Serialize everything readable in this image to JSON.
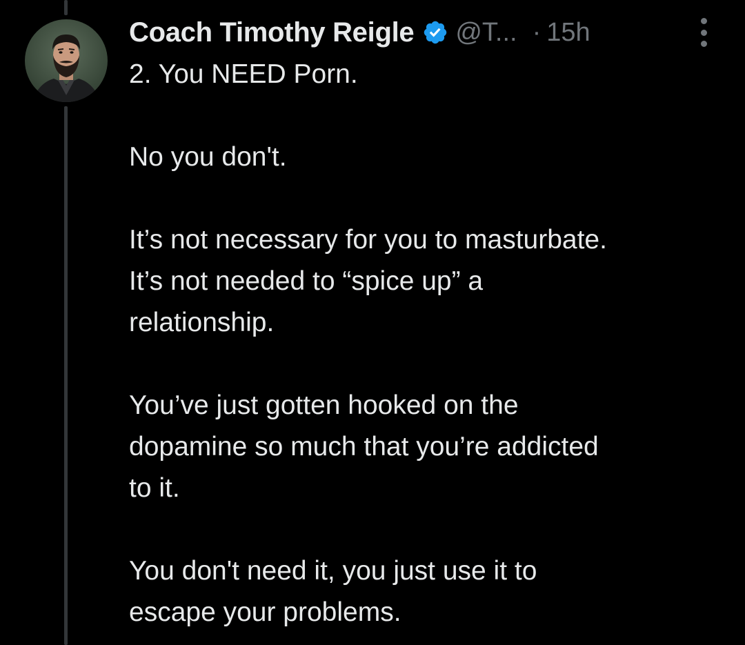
{
  "tweet": {
    "author": {
      "display_name": "Coach Timothy Reigle",
      "handle": "@T...",
      "verified": true,
      "avatar_icon": "profile-photo-bearded-man"
    },
    "separator": "·",
    "time": "15h",
    "more_icon": "vertical-ellipsis-icon",
    "paragraphs": [
      [
        "2. You NEED Porn."
      ],
      [
        "No you don't."
      ],
      [
        "It’s not necessary for you to masturbate.",
        "It’s not needed to “spice up” a",
        "relationship."
      ],
      [
        "You’ve just gotten hooked on the",
        "dopamine so much that you’re addicted",
        "to it."
      ],
      [
        "You don't need it, you just use it to",
        "escape your problems."
      ]
    ]
  },
  "colors": {
    "background": "#000000",
    "text": "#e7e9ea",
    "secondary_text": "#71767b",
    "verified_badge": "#1d9bf0",
    "thread_line": "#333639"
  }
}
